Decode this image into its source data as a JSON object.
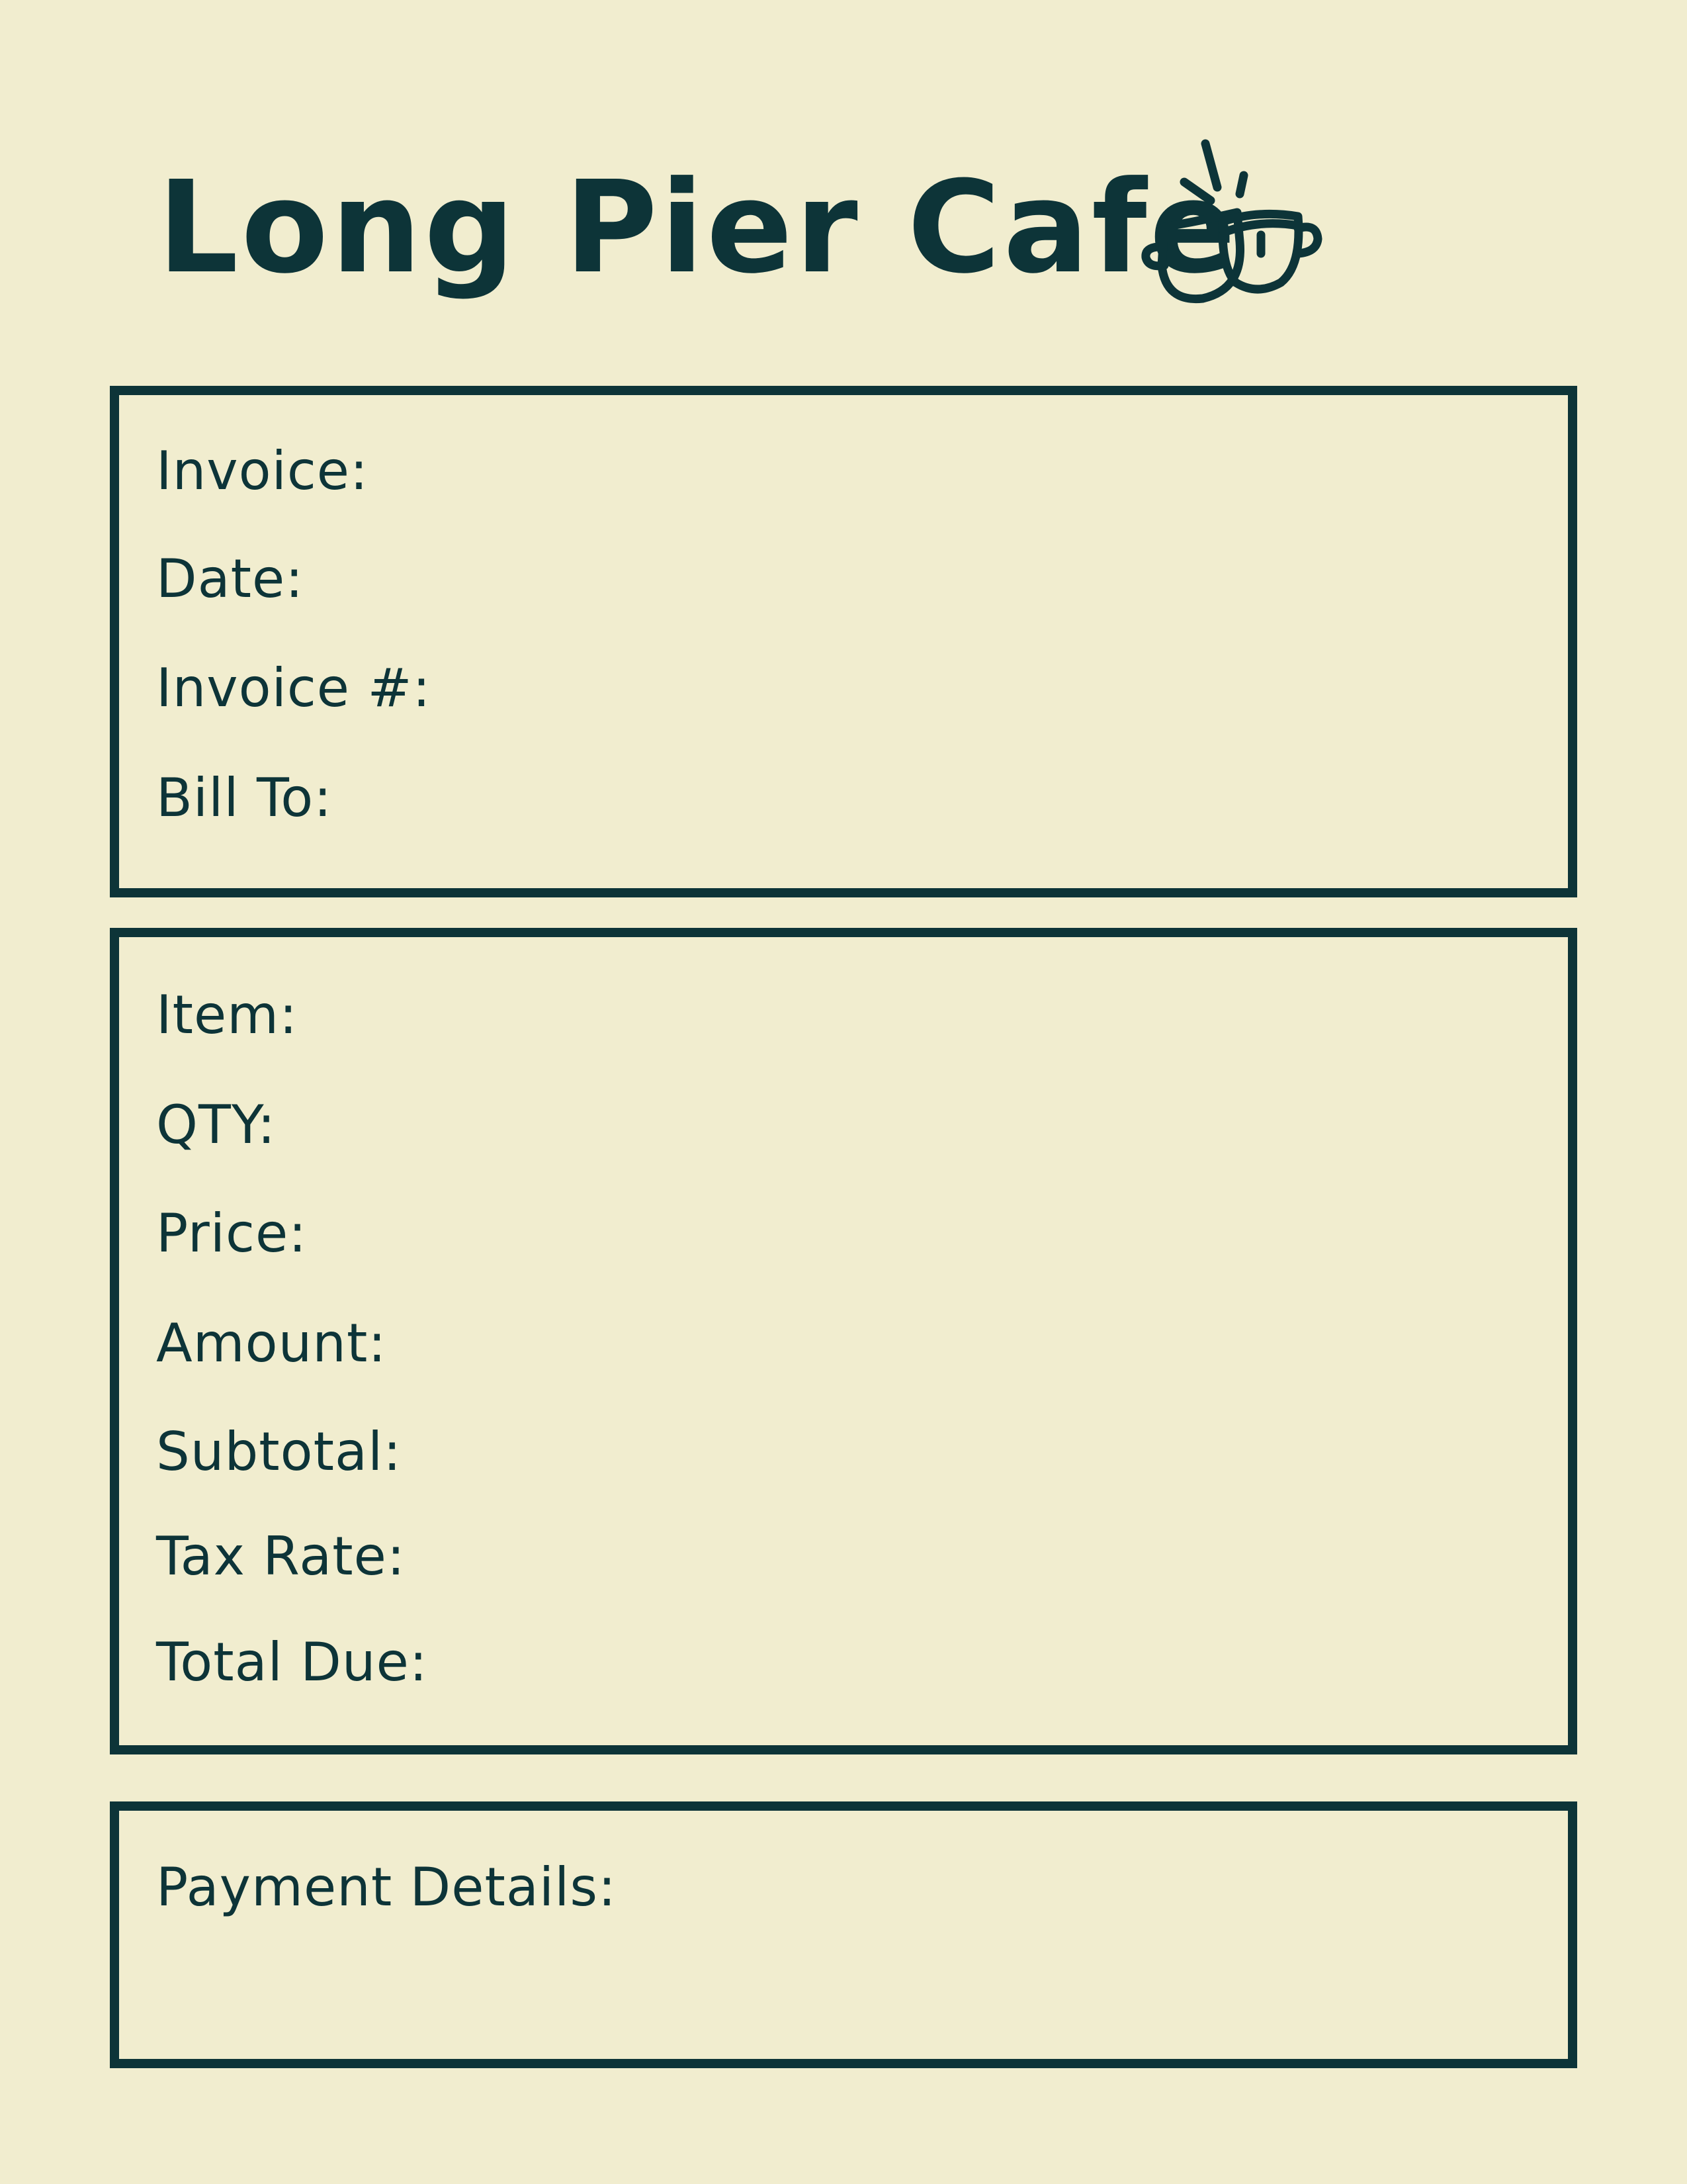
{
  "header": {
    "title": "Long Pier Cafe",
    "logo_icon": "coffee-cup-icon"
  },
  "invoice_section": {
    "invoice_label": "Invoice:",
    "date_label": "Date:",
    "invoice_number_label": "Invoice #:",
    "bill_to_label": "Bill To:"
  },
  "items_section": {
    "item_label": "Item:",
    "qty_label": "QTY:",
    "price_label": "Price:",
    "amount_label": "Amount:",
    "subtotal_label": "Subtotal:",
    "tax_rate_label": "Tax Rate:",
    "total_due_label": "Total Due:"
  },
  "payment_section": {
    "payment_details_label": "Payment Details:"
  },
  "colors": {
    "background": "#f1edcf",
    "ink": "#0d3438"
  }
}
